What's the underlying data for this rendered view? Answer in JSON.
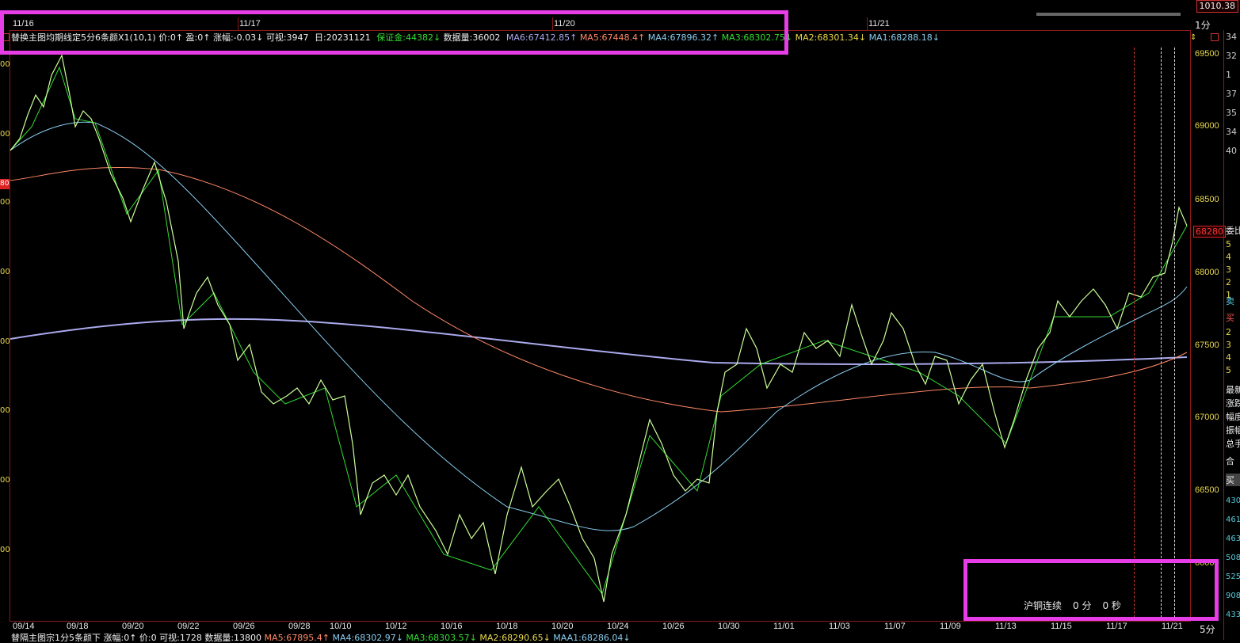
{
  "top_strip": {
    "dates": [
      "11/16",
      "11/17",
      "11/20",
      "11/21"
    ],
    "timeframe": "1分",
    "price": "1010.38"
  },
  "info_bar": {
    "title": "替换主图均期线定5分6条颜X1(10,1)",
    "price": "价:0↑",
    "profit": "盈:0↑",
    "change": "涨幅:-0.03↓",
    "visible": "可视:3947",
    "date": "日:20231121",
    "margin": "保证金:44382↓",
    "data_count": "数据量:36002",
    "ma6": "MA6:67412.85↑",
    "ma5": "MA5:67448.4↑",
    "ma4": "MA4:67896.32↑",
    "ma3": "MA3:68302.75↓",
    "ma2": "MA2:68301.34↓",
    "ma1": "MA1:68288.18↓"
  },
  "colors": {
    "ma6": "#aaaaee",
    "ma5": "#ff8866",
    "ma4": "#88ccee",
    "ma3": "#33dd33",
    "ma2": "#e8d84a",
    "ma1": "#88ccee",
    "price_line": "#ccff99",
    "axis": "#e8d84a",
    "highlight": "#e63de6"
  },
  "y_axis": [
    "69500",
    "69000",
    "68500",
    "68000",
    "67500",
    "67000",
    "66500",
    "66000"
  ],
  "left_axis_partial": [
    "00",
    "00",
    "80",
    "00",
    "00",
    "00",
    "00",
    "00",
    "00"
  ],
  "current_price": "68280",
  "x_axis": [
    "09/14",
    "09/18",
    "09/20",
    "09/22",
    "09/26",
    "09/28",
    "10/10",
    "10/12",
    "10/16",
    "10/18",
    "10/20",
    "10/24",
    "10/26",
    "10/30",
    "11/01",
    "11/03",
    "11/07",
    "11/09",
    "11/13",
    "11/15",
    "11/17",
    "11/21"
  ],
  "right_panel": [
    "34",
    "32",
    "1",
    "37",
    "35",
    "34",
    "40",
    "委比",
    "5",
    "4",
    "3",
    "2",
    "1",
    "卖",
    "买",
    "2",
    "3",
    "4",
    "5",
    "最新",
    "涨跌",
    "幅度",
    "振幅",
    "总手",
    "合",
    "买",
    "430",
    "461",
    "463",
    "508",
    "525",
    "908",
    "433"
  ],
  "session": {
    "name": "沪铜连续",
    "minutes": "0 分",
    "seconds": "0 秒"
  },
  "timeframe_bottom": "5分",
  "bottom_bar": {
    "title": "替隔主图宗1分5条颜下",
    "change": "涨幅:0↑",
    "price": "价:0",
    "visible": "可视:1728",
    "data_count": "数据量:13800",
    "ma5": "MA5:67895.4↑",
    "ma4": "MA4:68302.97↓",
    "ma3": "MA3:68303.57↓",
    "ma2": "MA2:68290.65↓",
    "ma1": "MAA1:68286.04↓"
  }
}
